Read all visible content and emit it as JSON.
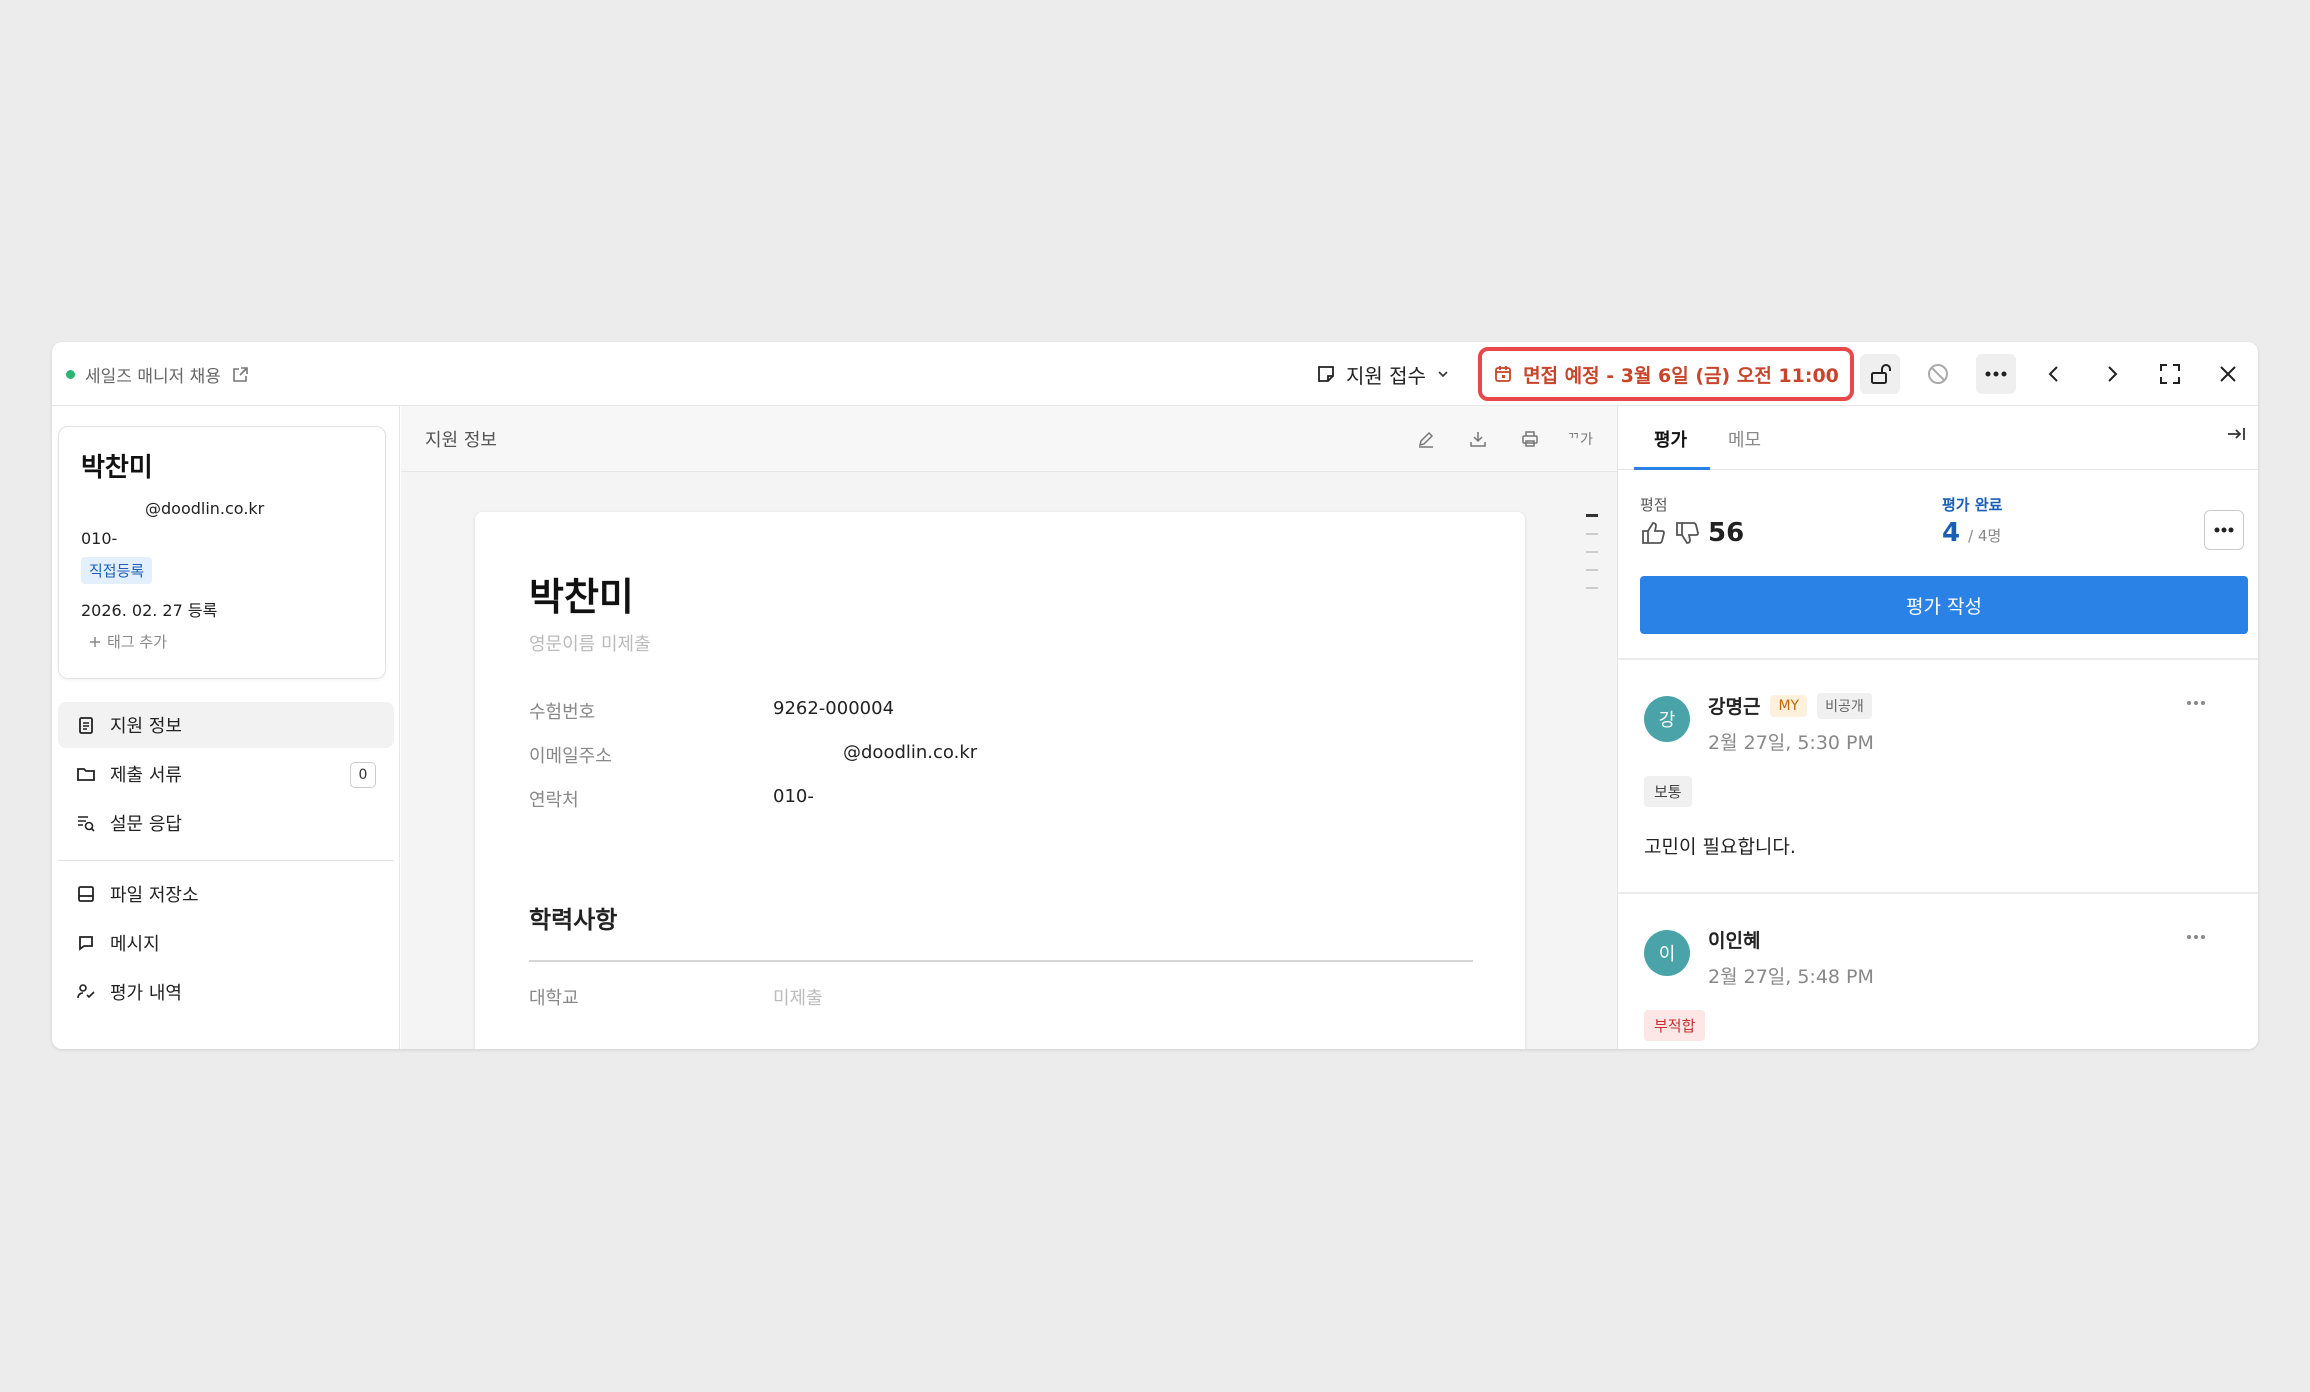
{
  "topbar": {
    "job_title": "세일즈 매니저 채용",
    "status_label": "지원 접수",
    "interview_label": "면접 예정 - 3월 6일 (금) 오전 11:00"
  },
  "candidate": {
    "name": "박찬미",
    "email": "@doodlin.co.kr",
    "phone": "010-",
    "badge": "직접등록",
    "registered": "2026. 02. 27  등록",
    "add_tag": "태그 추가"
  },
  "sidebar": {
    "items": [
      {
        "label": "지원 정보"
      },
      {
        "label": "제출 서류",
        "count": "0"
      },
      {
        "label": "설문 응답"
      },
      {
        "label": "파일 저장소"
      },
      {
        "label": "메시지"
      },
      {
        "label": "평가 내역"
      }
    ]
  },
  "center": {
    "title": "지원 정보",
    "font_btn": "ᄁ가",
    "doc": {
      "name": "박찬미",
      "english_name": "영문이름 미제출",
      "fields": [
        {
          "label": "수험번호",
          "value": "9262-000004"
        },
        {
          "label": "이메일주소",
          "value": "@doodlin.co.kr"
        },
        {
          "label": "연락처",
          "value": "010-"
        }
      ],
      "section_title": "학력사항",
      "education": [
        {
          "label": "대학교",
          "value": "미제출"
        }
      ]
    }
  },
  "right": {
    "tabs": [
      "평가",
      "메모"
    ],
    "score_label": "평점",
    "score_value": "56",
    "done_label": "평가 완료",
    "done_count": "4",
    "done_total": "/ 4명",
    "eval_button": "평가 작성",
    "reviews": [
      {
        "avatar": "강",
        "name": "강명근",
        "my": "MY",
        "visibility": "비공개",
        "date": "2월 27일, 5:30 PM",
        "grade": "보통",
        "comment": "고민이 필요합니다."
      },
      {
        "avatar": "이",
        "name": "이인혜",
        "date": "2월 27일, 5:48 PM",
        "grade": "부적합"
      }
    ]
  },
  "colors": {
    "accent": "#2a82e6",
    "interview_border": "#e8484a",
    "interview_text": "#c8442a",
    "avatar": "#4aa3a8"
  }
}
